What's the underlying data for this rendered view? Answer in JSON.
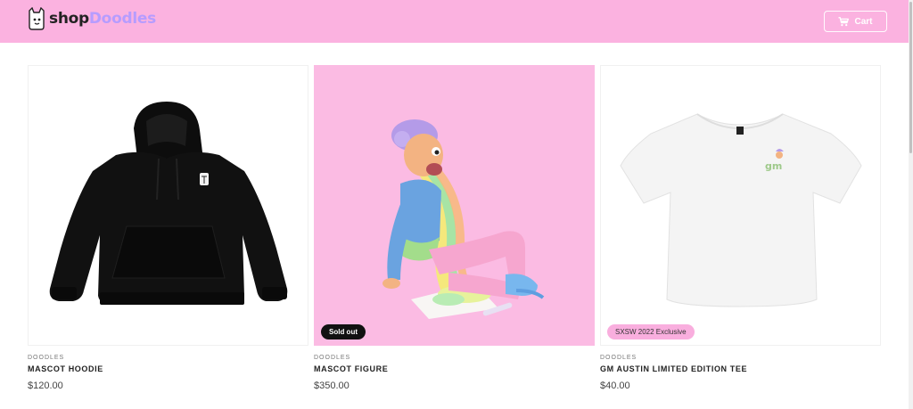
{
  "header": {
    "logo_text_shop": "shop",
    "logo_text_doodles": "Doodles",
    "cart_label": "Cart",
    "background": "#fbb2e0"
  },
  "products": [
    {
      "vendor": "DOODLES",
      "title": "MASCOT HOODIE",
      "price": "$120.00",
      "badge": ""
    },
    {
      "vendor": "DOODLES",
      "title": "MASCOT FIGURE",
      "price": "$350.00",
      "badge": "Sold out"
    },
    {
      "vendor": "DOODLES",
      "title": "GM AUSTIN LIMITED EDITION TEE",
      "price": "$40.00",
      "badge": "SXSW 2022 Exclusive"
    }
  ],
  "colors": {
    "brand_pink": "#fbb2e0",
    "figure_background": "#fbbbe3",
    "badge_sold_bg": "#111111",
    "badge_exclusive_bg": "#f9aede"
  }
}
